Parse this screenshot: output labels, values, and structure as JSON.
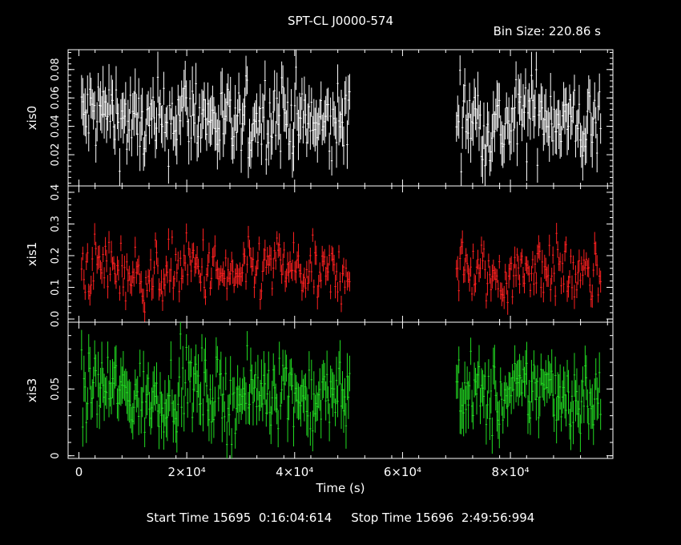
{
  "header": {
    "title": "SPT-CL J0000-574",
    "bin_size": "Bin Size: 220.86 s"
  },
  "footer": {
    "start_label": "Start Time",
    "start_value": "15695  0:16:04:614",
    "stop_label": "Stop Time",
    "stop_value": "15696  2:49:56:994"
  },
  "chart_data": {
    "type": "scatter",
    "title": "SPT-CL J0000-574",
    "xlabel": "Time (s)",
    "xlim": [
      -2000,
      99000
    ],
    "x_ticks": [
      0,
      20000,
      40000,
      60000,
      80000
    ],
    "x_tick_labels": [
      "0",
      "2×10⁴",
      "4×10⁴",
      "6×10⁴",
      "8×10⁴"
    ],
    "gti_segments": [
      [
        500,
        50400
      ],
      [
        70000,
        96800
      ]
    ],
    "bin_size_s": 220.86,
    "panels": [
      {
        "name": "xis0",
        "ylabel": "xis0",
        "color": "#ffffff",
        "ylim": [
          -0.002,
          0.094
        ],
        "y_ticks": [
          0.02,
          0.04,
          0.06,
          0.08
        ],
        "y_tick_labels": [
          "0.02",
          "0.04",
          "0.06",
          "0.08"
        ],
        "mean": 0.045,
        "spread": 0.018,
        "err": 0.014
      },
      {
        "name": "xis1",
        "ylabel": "xis1",
        "color": "#ff2020",
        "ylim": [
          -0.01,
          0.42
        ],
        "y_ticks": [
          0.0,
          0.1,
          0.2,
          0.3,
          0.4
        ],
        "y_tick_labels": [
          "0.0",
          "0.1",
          "0.2",
          "0.3",
          "0.4"
        ],
        "mean": 0.15,
        "spread": 0.06,
        "err": 0.03
      },
      {
        "name": "xis3",
        "ylabel": "xis3",
        "color": "#22dd22",
        "ylim": [
          -0.002,
          0.1
        ],
        "y_ticks": [
          0.0,
          0.05
        ],
        "y_tick_labels": [
          "0",
          "0.05"
        ],
        "mean": 0.047,
        "spread": 0.017,
        "err": 0.014
      }
    ]
  }
}
